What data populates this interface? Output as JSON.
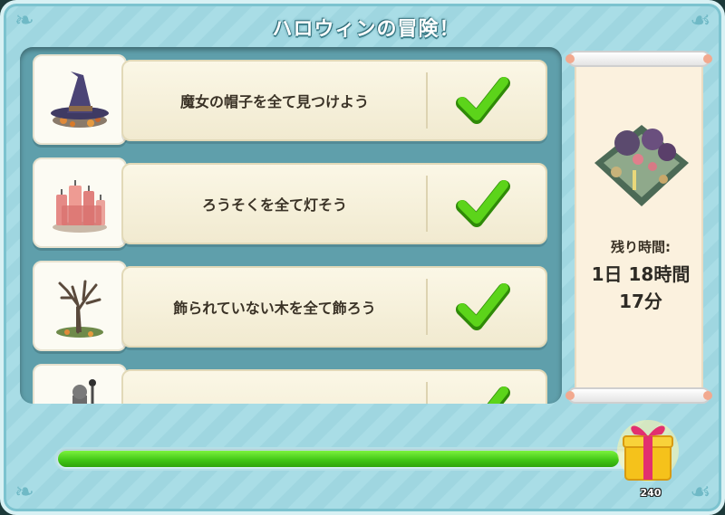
{
  "title": "ハロウィンの冒険！",
  "quests": [
    {
      "label": "魔女の帽子を全て見つけよう",
      "icon": "witch-hat-icon",
      "completed": true
    },
    {
      "label": "ろうそくを全て灯そう",
      "icon": "candles-icon",
      "completed": true
    },
    {
      "label": "飾られていない木を全て飾ろう",
      "icon": "bare-tree-icon",
      "completed": true
    },
    {
      "label": "",
      "icon": "lantern-statue-icon",
      "completed": true
    }
  ],
  "reward_panel": {
    "time_label": "残り時間:",
    "time_value_line1": "1日 18時間",
    "time_value_line2": "17分"
  },
  "progress": {
    "fraction": 0.95,
    "reward_count": "240"
  },
  "colors": {
    "check": "#48c20c",
    "progress_fill": "#3fc514",
    "gift_box": "#f5c21b",
    "gift_ribbon": "#e2306f"
  }
}
